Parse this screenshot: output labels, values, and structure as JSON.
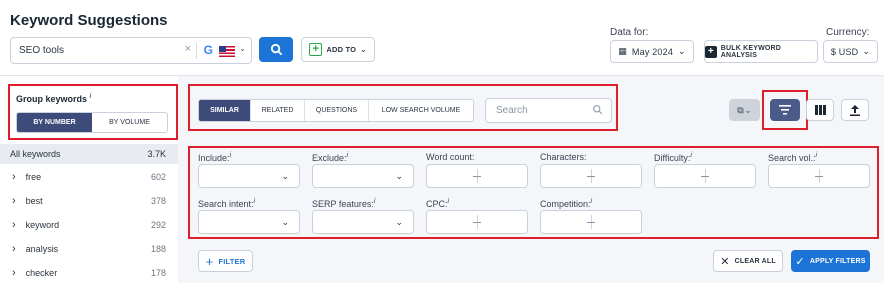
{
  "header": {
    "title": "Keyword Suggestions"
  },
  "search": {
    "value": "SEO tools",
    "clear": "×",
    "google": "G",
    "chevron": "⌄",
    "search_icon": "🔍"
  },
  "addto": {
    "label": "ADD TO",
    "icon": "+",
    "chevron": "⌄"
  },
  "data_for": {
    "label": "Data for:",
    "value": "May 2024",
    "chevron": "⌄",
    "calendar_icon": "▦"
  },
  "bulk": {
    "label": "BULK KEYWORD ANALYSIS",
    "icon": "+"
  },
  "currency": {
    "label": "Currency:",
    "value": "$ USD",
    "chevron": "⌄"
  },
  "group": {
    "label": "Group keywords",
    "info": "i",
    "options": [
      "BY NUMBER",
      "BY VOLUME"
    ],
    "selected": "BY NUMBER"
  },
  "keywords": {
    "all": {
      "label": "All keywords",
      "count": "3.7K"
    },
    "items": [
      {
        "label": "free",
        "count": "602"
      },
      {
        "label": "best",
        "count": "378"
      },
      {
        "label": "keyword",
        "count": "292"
      },
      {
        "label": "analysis",
        "count": "188"
      },
      {
        "label": "checker",
        "count": "178"
      }
    ]
  },
  "tabs": [
    "SIMILAR",
    "RELATED",
    "QUESTIONS",
    "LOW SEARCH VOLUME"
  ],
  "active_tab": "SIMILAR",
  "table_search": {
    "placeholder": "Search",
    "icon": "⚲"
  },
  "toolbar": {
    "copy_icon": "⧉",
    "copy_chev": "⌄",
    "filter_icon": "≡",
    "columns_icon": "▥",
    "export_icon": "⤒"
  },
  "filters": {
    "include": "Include:",
    "exclude": "Exclude:",
    "word_count": "Word count:",
    "characters": "Characters:",
    "difficulty": "Difficulty:",
    "search_vol": "Search vol.:",
    "search_intent": "Search intent:",
    "serp_features": "SERP features:",
    "cpc": "CPC:",
    "competition": "Competition:",
    "info": "i",
    "chevron": "⌄"
  },
  "buttons": {
    "filter": "FILTER",
    "filter_icon": "+",
    "clear": "CLEAR ALL",
    "clear_icon": "✕",
    "apply": "APPLY FILTERS",
    "apply_icon": "✓"
  },
  "colors": {
    "accent": "#1d74d7",
    "active_tab": "#3c4b7a",
    "highlight": "#dc1f2a"
  }
}
